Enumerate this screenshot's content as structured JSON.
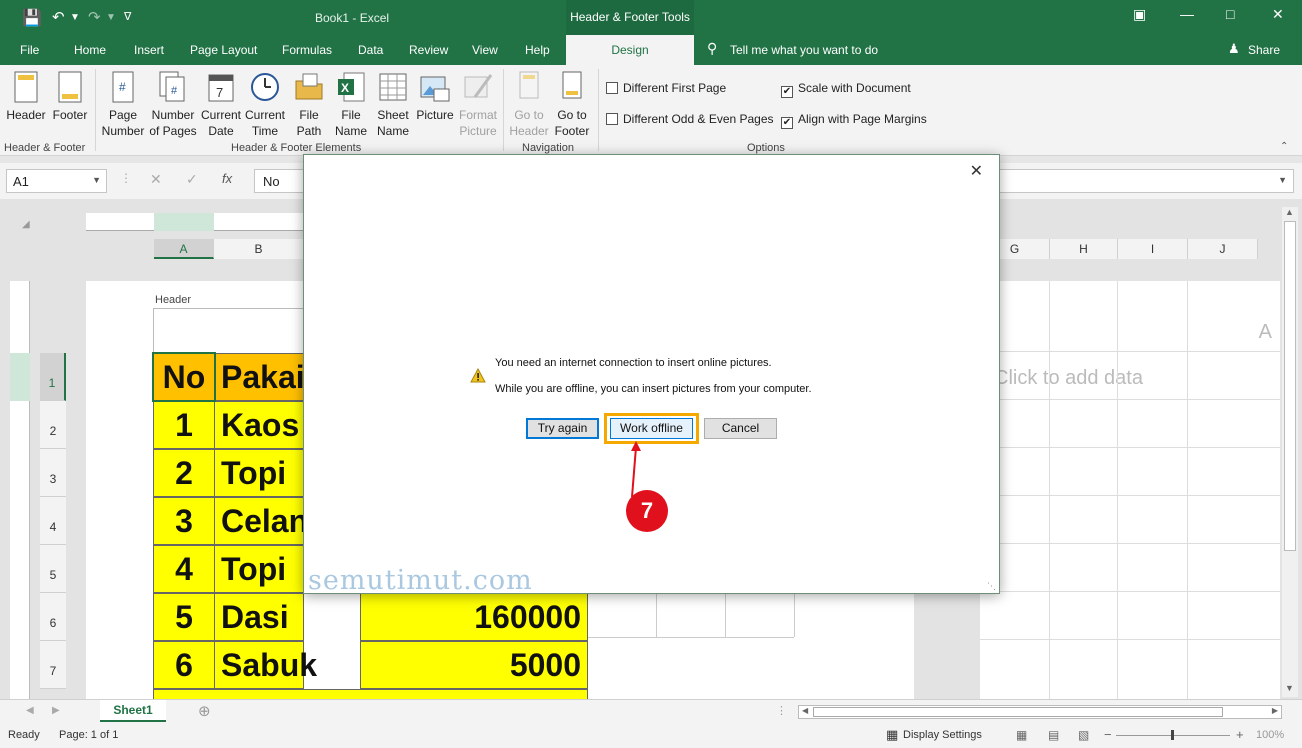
{
  "window": {
    "title": "Book1  -  Excel",
    "contextual_group": "Header & Footer Tools",
    "controls": [
      "minimize",
      "restore",
      "close"
    ]
  },
  "tabs": [
    "File",
    "Home",
    "Insert",
    "Page Layout",
    "Formulas",
    "Data",
    "Review",
    "View",
    "Help"
  ],
  "active_tab": "Design",
  "tell_me": "Tell me what you want to do",
  "share": "Share",
  "ribbon": {
    "group1": {
      "label": "Header & Footer",
      "header": "Header",
      "footer": "Footer"
    },
    "group2": {
      "label": "Header & Footer Elements",
      "page_number": [
        "Page",
        "Number"
      ],
      "number_of_pages": [
        "Number",
        "of Pages"
      ],
      "current_date": [
        "Current",
        "Date"
      ],
      "current_time": [
        "Current",
        "Time"
      ],
      "file_path": [
        "File",
        "Path"
      ],
      "file_name": [
        "File",
        "Name"
      ],
      "sheet_name": [
        "Sheet",
        "Name"
      ],
      "picture": "Picture",
      "format_picture": [
        "Format",
        "Picture"
      ]
    },
    "group3": {
      "label": "Navigation",
      "go_header": [
        "Go to",
        "Header"
      ],
      "go_footer": [
        "Go to",
        "Footer"
      ]
    },
    "group4": {
      "label": "Options",
      "diff_first": "Different First Page",
      "diff_odd_even": "Different Odd & Even Pages",
      "scale_doc": "Scale with Document",
      "align_margins": "Align with Page Margins",
      "diff_first_checked": false,
      "diff_odd_even_checked": false,
      "scale_doc_checked": true,
      "align_margins_checked": true
    }
  },
  "formula_bar": {
    "name_box": "A1",
    "content": "No"
  },
  "columns": [
    "A",
    "B",
    "G",
    "H",
    "I",
    "J"
  ],
  "rows": [
    "1",
    "2",
    "3",
    "4",
    "5",
    "6",
    "7"
  ],
  "sheet": {
    "header_label": "Header",
    "click_to_add": "Click to add data",
    "stray_A": "A",
    "table": [
      {
        "no": "No",
        "name": "Pakai",
        "price": ""
      },
      {
        "no": "1",
        "name": "Kaos",
        "price": ""
      },
      {
        "no": "2",
        "name": "Topi",
        "price": ""
      },
      {
        "no": "3",
        "name": "Celan",
        "price": ""
      },
      {
        "no": "4",
        "name": "Topi",
        "price": ""
      },
      {
        "no": "5",
        "name": "Dasi",
        "price": "160000"
      },
      {
        "no": "6",
        "name": "Sabuk",
        "price": "5000"
      }
    ]
  },
  "dialog": {
    "line1": "You need an internet connection to insert online pictures.",
    "line2": "While you are offline, you can insert pictures from your computer.",
    "try_again": "Try again",
    "work_offline": "Work offline",
    "cancel": "Cancel",
    "callout_number": "7",
    "watermark": "semutimut.com"
  },
  "sheet_tab": "Sheet1",
  "status": {
    "ready": "Ready",
    "page": "Page: 1 of 1",
    "display_settings": "Display Settings",
    "zoom": "100%"
  },
  "colors": {
    "excel_green": "#217346",
    "highlight": "#ffff00",
    "header_orange": "#ffc000",
    "callout_red": "#e0101c",
    "focus_outline": "#f5a800"
  }
}
